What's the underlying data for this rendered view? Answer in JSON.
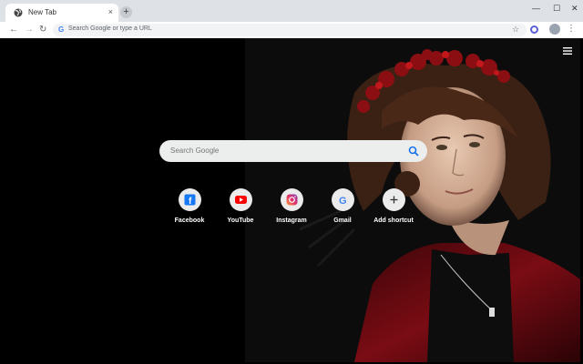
{
  "browser": {
    "tab_title": "New Tab",
    "tab_close": "×",
    "new_tab": "+",
    "window_controls": [
      "—",
      "☐",
      "✕"
    ],
    "omnibox_placeholder": "Search Google or type a URL"
  },
  "page": {
    "search_placeholder": "Search Google",
    "shortcuts": [
      {
        "label": "Facebook",
        "icon": "facebook-icon"
      },
      {
        "label": "YouTube",
        "icon": "youtube-icon"
      },
      {
        "label": "Instagram",
        "icon": "instagram-icon"
      },
      {
        "label": "Gmail",
        "icon": "google-icon"
      },
      {
        "label": "Add shortcut",
        "icon": "plus-icon"
      }
    ]
  },
  "colors": {
    "chrome_bg": "#dee1e6",
    "accent_blue": "#1a73e8",
    "facebook": "#1877f2",
    "youtube": "#ff0000",
    "jacket_red": "#7a0c14"
  }
}
